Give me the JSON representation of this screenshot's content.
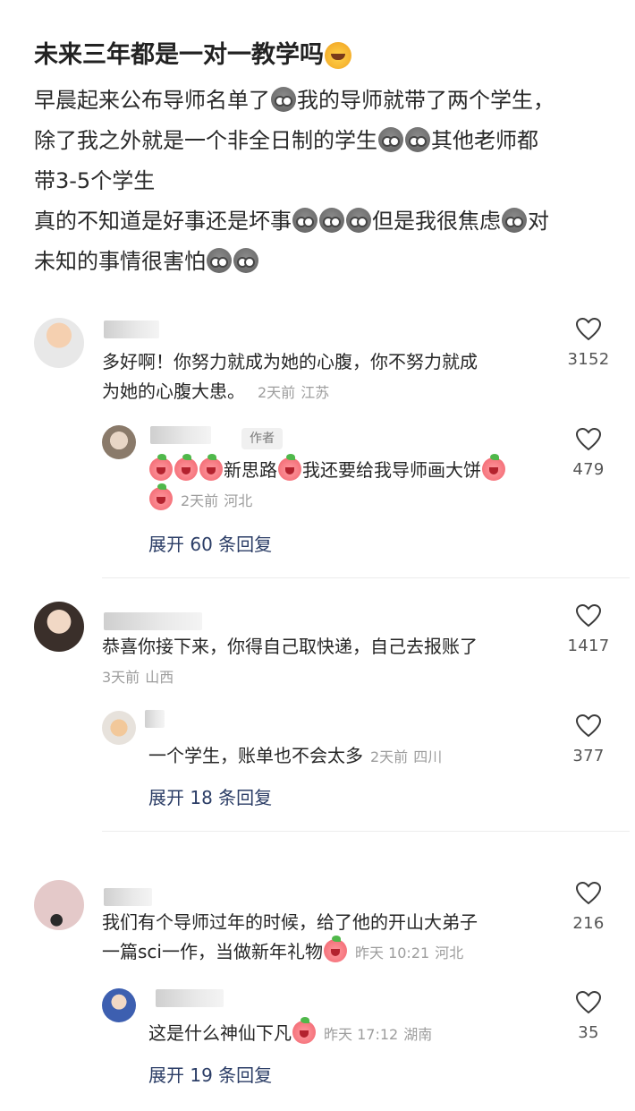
{
  "post": {
    "title": "未来三年都是一对一教学吗",
    "body_lines": [
      [
        "早晨起来公布导师名单了",
        "[grey]",
        "我的导师就带了两个学生，"
      ],
      [
        "除了我之外就是一个非全日制的学生",
        "[grey]",
        "[grey]",
        "其他老师都"
      ],
      [
        "带3-5个学生"
      ],
      [
        "真的不知道是好事还是坏事",
        "[grey]",
        "[grey]",
        "[grey]",
        "但是我很焦虑",
        "[grey]",
        "对"
      ],
      [
        "未知的事情很害怕",
        "[grey]",
        "[grey]"
      ]
    ]
  },
  "comments": [
    {
      "text_line1": "多好啊！你努力就成为她的心腹，你不努力就成",
      "text_line2": "为她的心腹大患。",
      "time": "2天前",
      "location": "江苏",
      "likes": "3152",
      "reply": {
        "author_tag": "作者",
        "text_line1": "新思路",
        "text_line1b": "我还要给我导师画大饼",
        "time": "2天前",
        "location": "河北",
        "likes": "479"
      },
      "expand": "展开 60 条回复"
    },
    {
      "text_line1": "恭喜你接下来，你得自己取快递，自己去报账了",
      "time": "3天前",
      "location": "山西",
      "likes": "1417",
      "reply": {
        "text": "一个学生，账单也不会太多",
        "time": "2天前",
        "location": "四川",
        "likes": "377"
      },
      "expand": "展开 18 条回复"
    },
    {
      "text_line1": "我们有个导师过年的时候，给了他的开山大弟子",
      "text_line2": "一篇sci一作，当做新年礼物",
      "time": "昨天 10:21",
      "location": "河北",
      "likes": "216",
      "reply": {
        "text": "这是什么神仙下凡",
        "time": "昨天 17:12",
        "location": "湖南",
        "likes": "35"
      },
      "expand": "展开 19 条回复"
    }
  ],
  "icons": {
    "like": "heart-outline-icon",
    "emoji_grey": "grey-shocked-emoji-icon",
    "emoji_peach": "crying-peach-emoji-icon",
    "emoji_blast": "mind-blown-emoji-icon"
  },
  "colors": {
    "expand_link": "#2b3d66",
    "meta": "#9d9d9d"
  }
}
